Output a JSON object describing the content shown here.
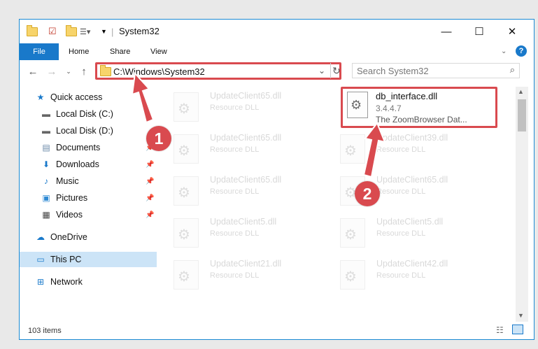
{
  "window": {
    "title": "System32"
  },
  "ribbon": {
    "tabs": [
      "File",
      "Home",
      "Share",
      "View"
    ]
  },
  "address": {
    "path": "C:\\Windows\\System32"
  },
  "search": {
    "placeholder": "Search System32"
  },
  "nav": {
    "quick_access": "Quick access",
    "items": [
      {
        "label": "Local Disk (C:)",
        "icon": "disk-icon"
      },
      {
        "label": "Local Disk (D:)",
        "icon": "disk-icon"
      },
      {
        "label": "Documents",
        "icon": "document-icon"
      },
      {
        "label": "Downloads",
        "icon": "download-icon"
      },
      {
        "label": "Music",
        "icon": "music-icon"
      },
      {
        "label": "Pictures",
        "icon": "pictures-icon"
      },
      {
        "label": "Videos",
        "icon": "videos-icon"
      }
    ],
    "onedrive": "OneDrive",
    "this_pc": "This PC",
    "network": "Network"
  },
  "highlighted_file": {
    "name": "db_interface.dll",
    "version": "3.4.4.7",
    "description": "The ZoomBrowser Dat..."
  },
  "files": [
    {
      "name": "UpdateClient65.dll",
      "type": "Resource DLL"
    },
    {
      "name": "UpdateClient65.dll",
      "type": "Resource DLL"
    },
    {
      "name": "UpdateClient39.dll",
      "type": "Resource DLL"
    },
    {
      "name": "UpdateClient65.dll",
      "type": "Resource DLL"
    },
    {
      "name": "UpdateClient65.dll",
      "type": "Resource DLL"
    },
    {
      "name": "UpdateClient5.dll",
      "type": "Resource DLL"
    },
    {
      "name": "UpdateClient5.dll",
      "type": "Resource DLL"
    },
    {
      "name": "UpdateClient21.dll",
      "type": "Resource DLL"
    },
    {
      "name": "UpdateClient42.dll",
      "type": "Resource DLL"
    }
  ],
  "status": {
    "item_count": "103 items"
  },
  "annotations": {
    "step1": "1",
    "step2": "2",
    "color": "#d94a4f"
  }
}
